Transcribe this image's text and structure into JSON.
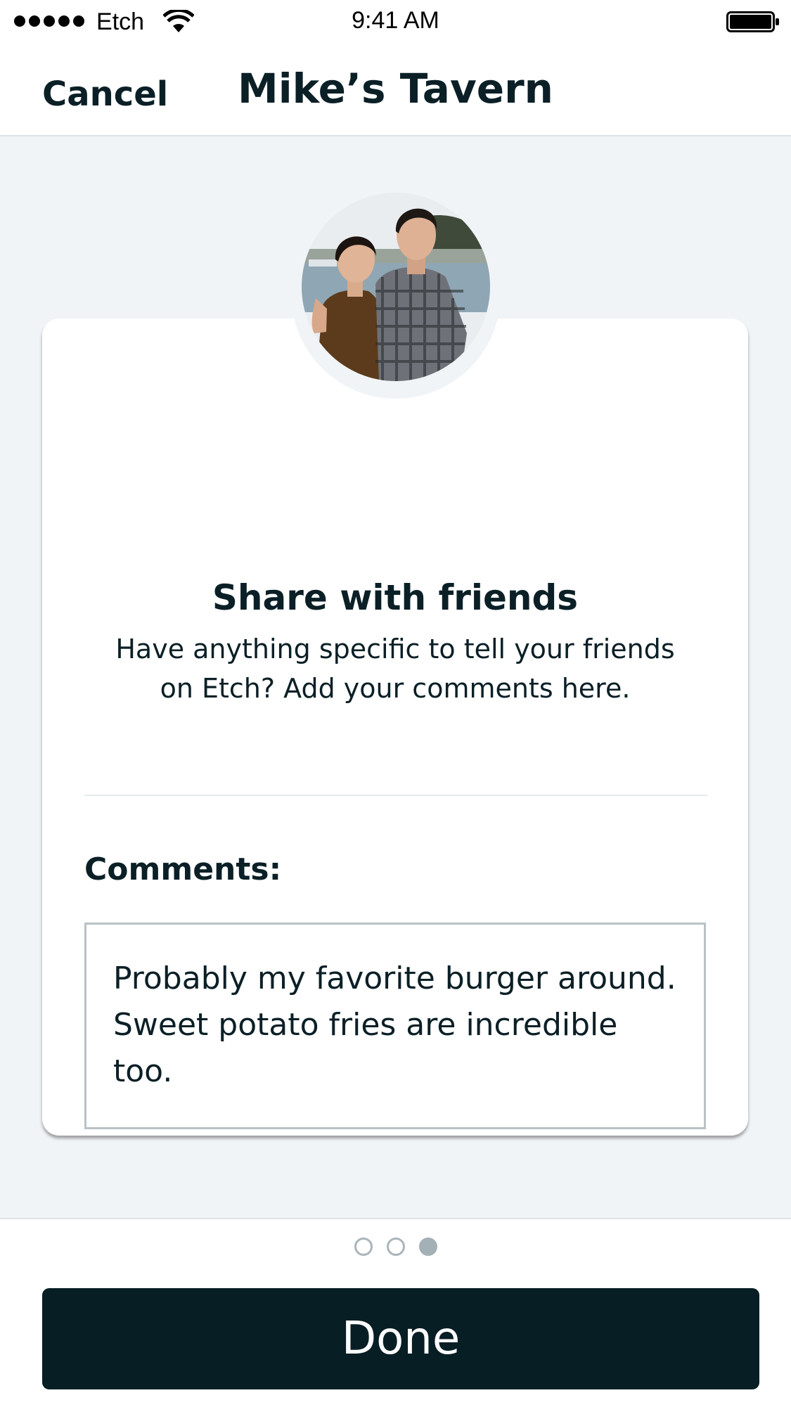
{
  "status_bar": {
    "carrier": "Etch",
    "time": "9:41 AM"
  },
  "nav": {
    "cancel_label": "Cancel",
    "title": "Mike’s Tavern"
  },
  "card": {
    "title": "Share with friends",
    "subtitle_line1": "Have anything specific to tell your friends",
    "subtitle_line2": "on Etch? Add your comments here.",
    "comments_label": "Comments:",
    "comments_value": "Probably my favorite burger around. Sweet potato fries are incredible too."
  },
  "pager": {
    "total_pages": 3,
    "current_page": 3
  },
  "footer": {
    "done_label": "Done"
  },
  "colors": {
    "primary_dark": "#071e24",
    "background": "#f1f4f7",
    "indicator": "#a3b0b6"
  }
}
